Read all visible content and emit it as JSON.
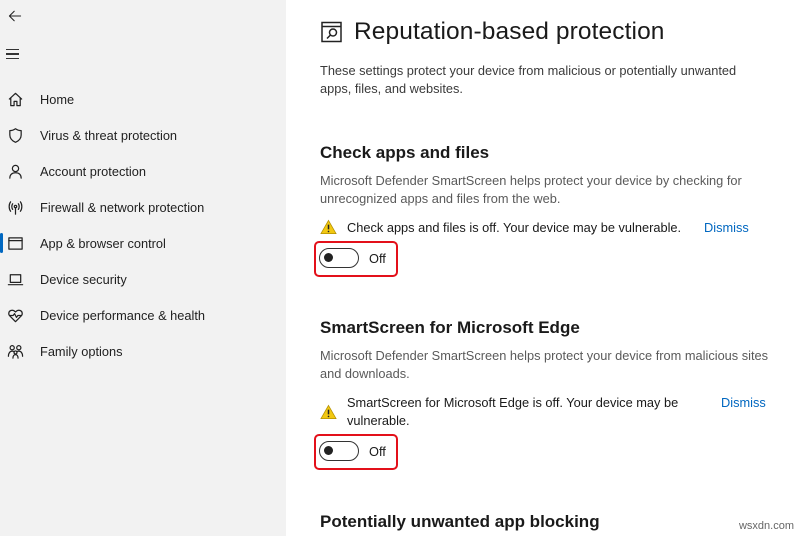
{
  "sidebar": {
    "items": [
      {
        "label": "Home",
        "icon": "home-icon"
      },
      {
        "label": "Virus & threat protection",
        "icon": "shield-icon"
      },
      {
        "label": "Account protection",
        "icon": "person-icon"
      },
      {
        "label": "Firewall & network protection",
        "icon": "antenna-icon"
      },
      {
        "label": "App & browser control",
        "icon": "app-window-icon",
        "active": true
      },
      {
        "label": "Device security",
        "icon": "laptop-icon"
      },
      {
        "label": "Device performance & health",
        "icon": "heart-pulse-icon"
      },
      {
        "label": "Family options",
        "icon": "family-icon"
      }
    ]
  },
  "main": {
    "title": "Reputation-based protection",
    "description": "These settings protect your device from malicious or potentially unwanted apps, files, and websites.",
    "sections": [
      {
        "title": "Check apps and files",
        "description": "Microsoft Defender SmartScreen helps protect your device by checking for unrecognized apps and files from the web.",
        "warning": "Check apps and files is off. Your device may be vulnerable.",
        "dismiss": "Dismiss",
        "toggle_state": "Off"
      },
      {
        "title": "SmartScreen for Microsoft Edge",
        "description": "Microsoft Defender SmartScreen helps protect your device from malicious sites and downloads.",
        "warning": "SmartScreen for Microsoft Edge is off. Your device may be vulnerable.",
        "dismiss": "Dismiss",
        "toggle_state": "Off"
      },
      {
        "title": "Potentially unwanted app blocking"
      }
    ]
  },
  "watermark": "wsxdn.com",
  "colors": {
    "accent": "#0067c0",
    "highlight_box": "#e3101a",
    "warning": "#f2c811",
    "sidebar_bg": "#f2f2f2"
  }
}
